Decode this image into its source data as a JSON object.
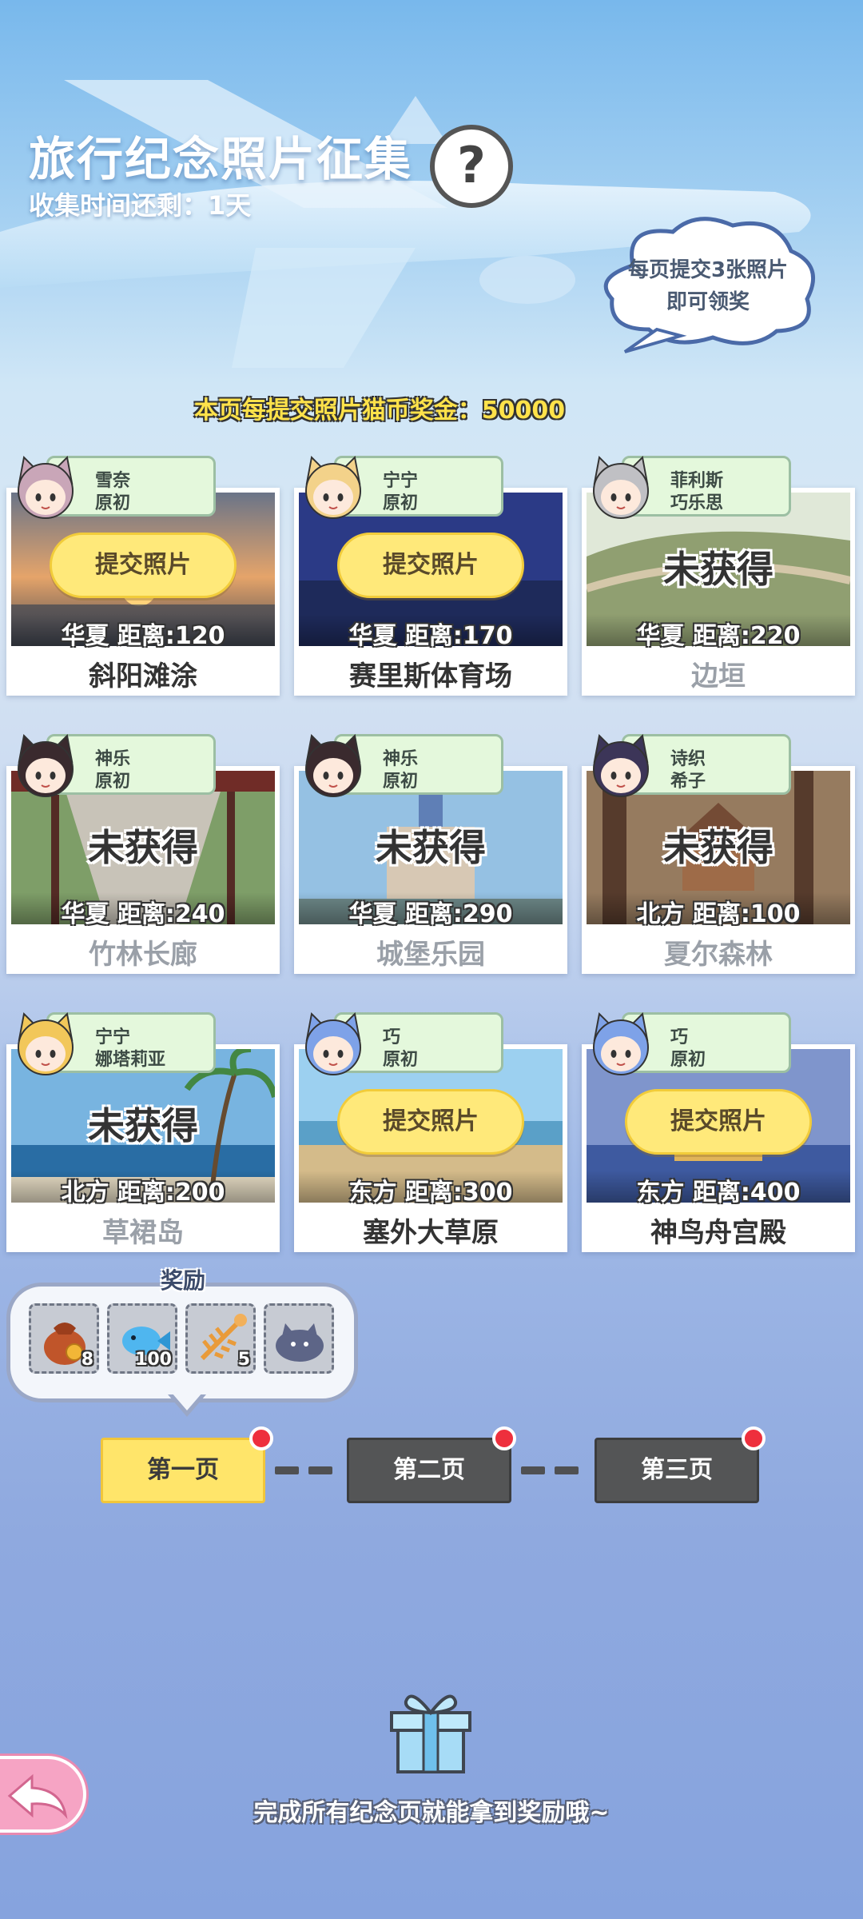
{
  "header": {
    "title": "旅行纪念照片征集",
    "help_symbol": "?",
    "timer_text": "收集时间还剩：1天",
    "cloud_line1": "每页提交3张照片",
    "cloud_line2": "即可领奖",
    "bonus_text": "本页每提交照片猫币奖金：50000"
  },
  "cards": [
    {
      "char1": "雪奈",
      "char2": "原初",
      "status": "submit",
      "action": "提交照片",
      "distance": "华夏  距离:120",
      "location": "斜阳滩涂",
      "avatar_color": "#c9a6b8",
      "scene": "sunset"
    },
    {
      "char1": "宁宁",
      "char2": "原初",
      "status": "submit",
      "action": "提交照片",
      "distance": "华夏  距离:170",
      "location": "赛里斯体育场",
      "avatar_color": "#f3d28a",
      "scene": "night"
    },
    {
      "char1": "菲利斯",
      "char2": "巧乐思",
      "status": "locked",
      "action": "未获得",
      "distance": "华夏  距离:220",
      "location": "边垣",
      "avatar_color": "#c0c0c4",
      "scene": "wall"
    },
    {
      "char1": "神乐",
      "char2": "原初",
      "status": "locked",
      "action": "未获得",
      "distance": "华夏  距离:240",
      "location": "竹林长廊",
      "avatar_color": "#3a2a2e",
      "scene": "corridor"
    },
    {
      "char1": "神乐",
      "char2": "原初",
      "status": "locked",
      "action": "未获得",
      "distance": "华夏  距离:290",
      "location": "城堡乐园",
      "avatar_color": "#3a2a2e",
      "scene": "castle"
    },
    {
      "char1": "诗织",
      "char2": "希子",
      "status": "locked",
      "action": "未获得",
      "distance": "北方  距离:100",
      "location": "夏尔森林",
      "avatar_color": "#3c3558",
      "scene": "forest"
    },
    {
      "char1": "宁宁",
      "char2": "娜塔莉亚",
      "status": "locked",
      "action": "未获得",
      "distance": "北方  距离:200",
      "location": "草裙岛",
      "avatar_color": "#f2c75a",
      "scene": "beach"
    },
    {
      "char1": "巧",
      "char2": "原初",
      "status": "submit",
      "action": "提交照片",
      "distance": "东方  距离:300",
      "location": "塞外大草原",
      "avatar_color": "#7ea2e8",
      "scene": "grass"
    },
    {
      "char1": "巧",
      "char2": "原初",
      "status": "submit",
      "action": "提交照片",
      "distance": "东方  距离:400",
      "location": "神鸟舟宫殿",
      "avatar_color": "#7ea2e8",
      "scene": "palace"
    }
  ],
  "rewards": {
    "title": "奖励",
    "items": [
      {
        "icon": "coin-bag-icon",
        "qty": "8"
      },
      {
        "icon": "blue-fish-icon",
        "qty": "100"
      },
      {
        "icon": "fish-bone-icon",
        "qty": "5"
      },
      {
        "icon": "cat-plush-icon",
        "qty": ""
      }
    ]
  },
  "pages": [
    {
      "label": "第一页",
      "active": true
    },
    {
      "label": "第二页",
      "active": false
    },
    {
      "label": "第三页",
      "active": false
    }
  ],
  "footer": {
    "hint": "完成所有纪念页就能拿到奖励哦~"
  },
  "colors": {
    "accent_yellow": "#ffe56a",
    "tag_green": "#e4f8dc",
    "badge_red": "#ee2f3d",
    "inactive_gray": "#545556"
  }
}
